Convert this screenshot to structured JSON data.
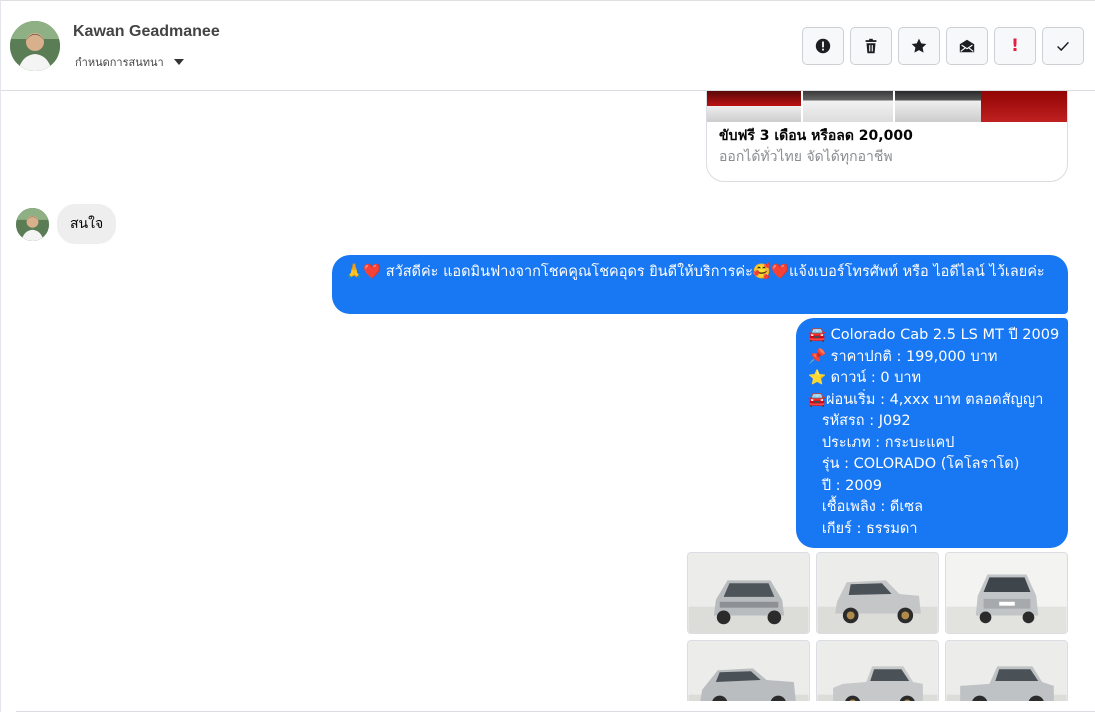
{
  "header": {
    "contact_name": "Kawan Geadmanee",
    "assign_label": "กำหนดการสนทนา",
    "actions": [
      {
        "name": "report-button",
        "icon": "alert-circle-icon"
      },
      {
        "name": "delete-button",
        "icon": "trash-icon"
      },
      {
        "name": "star-button",
        "icon": "star-icon"
      },
      {
        "name": "mark-unread-button",
        "icon": "envelope-icon"
      },
      {
        "name": "important-button",
        "icon": "exclamation-icon"
      },
      {
        "name": "done-button",
        "icon": "check-icon"
      }
    ]
  },
  "thread": {
    "link_card": {
      "title": "ขับฟรี 3 เดือน หรือลด 20,000",
      "subtitle": "ออกได้ทั่วไทย จัดได้ทุกอาชีพ"
    },
    "incoming_message": "สนใจ",
    "outgoing_greeting": "🙏❤️ สวัสดีค่ะ แอดมินฟางจากโชคคูณโชคอุดร ยินดีให้บริการค่ะ🥰❤️แจ้งเบอร์โทรศัพท์ หรือ ไอดีไลน์  ไว้เลยค่ะ",
    "outgoing_details": [
      "🚘 Colorado Cab 2.5 LS MT ปี 2009",
      "📌 ราคาปกติ : 199,000 บาท",
      "⭐ ดาวน์ : 0 บาท",
      "🚘ผ่อนเริ่ม : 4,xxx บาท ตลอดสัญญา",
      "   รหัสรถ : J092",
      "   ประเภท : กระบะแคป",
      "   รุ่น : COLORADO (โคโลราโด)",
      "   ปี : 2009",
      "   เชื้อเพลิง : ดีเซล",
      "   เกียร์ : ธรรมดา"
    ],
    "photo_count": 6
  },
  "colors": {
    "outgoing_bubble": "#1877f2",
    "incoming_bubble": "#eeeeee",
    "important_red": "#e41e3f"
  }
}
